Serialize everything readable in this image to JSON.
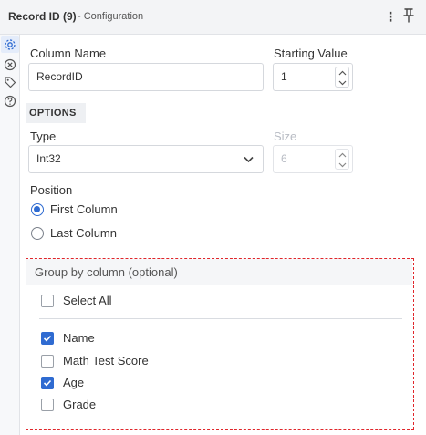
{
  "header": {
    "title": "Record ID (9)",
    "subtitle": "- Configuration",
    "menu_icon": "more-vertical-icon",
    "pin_icon": "pin-icon"
  },
  "sidebar": {
    "icons": [
      "gear-icon",
      "close-circle-icon",
      "tag-icon",
      "help-icon"
    ]
  },
  "column_name": {
    "label": "Column Name",
    "value": "RecordID"
  },
  "starting_value": {
    "label": "Starting Value",
    "value": "1"
  },
  "options": {
    "heading": "OPTIONS",
    "type": {
      "label": "Type",
      "value": "Int32"
    },
    "size": {
      "label": "Size",
      "value": "6"
    },
    "position": {
      "label": "Position",
      "choices": [
        {
          "label": "First Column",
          "selected": true
        },
        {
          "label": "Last Column",
          "selected": false
        }
      ]
    }
  },
  "group_by": {
    "heading": "Group by column (optional)",
    "select_all": {
      "label": "Select All",
      "checked": false
    },
    "columns": [
      {
        "label": "Name",
        "checked": true
      },
      {
        "label": "Math Test Score",
        "checked": false
      },
      {
        "label": "Age",
        "checked": true
      },
      {
        "label": "Grade",
        "checked": false
      }
    ]
  },
  "colors": {
    "accent": "#2f6bd1",
    "highlight_border": "#e0262b"
  }
}
